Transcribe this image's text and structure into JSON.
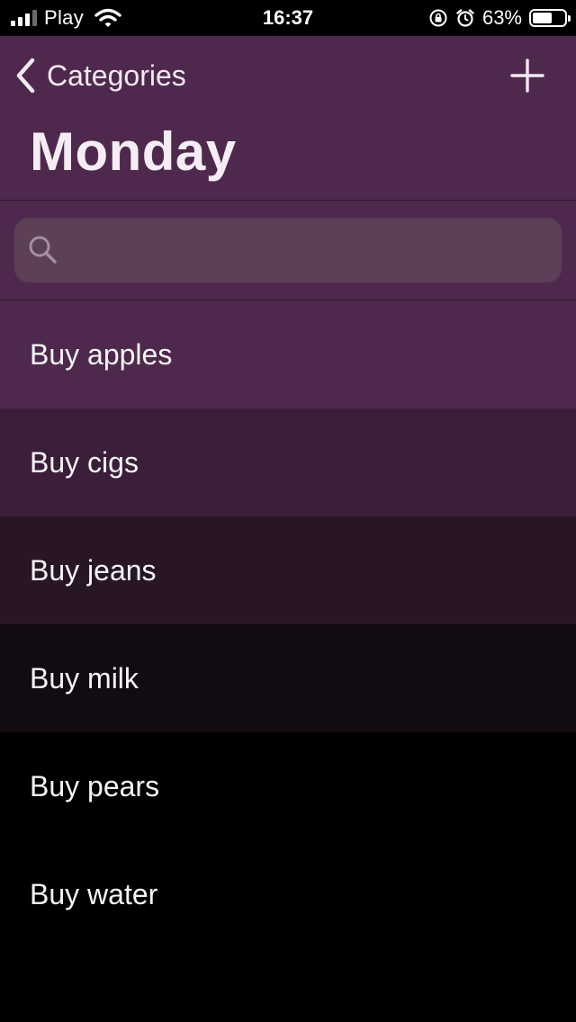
{
  "status_bar": {
    "carrier": "Play",
    "time": "16:37",
    "battery_percent_label": "63%",
    "battery_level": 0.63,
    "icons": [
      "signal-icon",
      "wifi-icon",
      "orientation-lock-icon",
      "alarm-icon",
      "battery-icon"
    ]
  },
  "nav": {
    "back_label": "Categories",
    "title": "Monday",
    "back_icon": "chevron-left-icon",
    "add_icon": "plus-icon"
  },
  "search": {
    "placeholder": "",
    "value": "",
    "icon": "search-icon"
  },
  "colors": {
    "accent": "#4f294d",
    "search_fill": "#5b4058",
    "background": "#000000"
  },
  "tasks": [
    {
      "label": "Buy apples",
      "color": "#4f294d"
    },
    {
      "label": "Buy cigs",
      "color": "#3b1f3a"
    },
    {
      "label": "Buy jeans",
      "color": "#281627"
    },
    {
      "label": "Buy milk",
      "color": "#120b12"
    },
    {
      "label": "Buy pears",
      "color": "#000000"
    },
    {
      "label": "Buy water",
      "color": "#000000"
    }
  ]
}
